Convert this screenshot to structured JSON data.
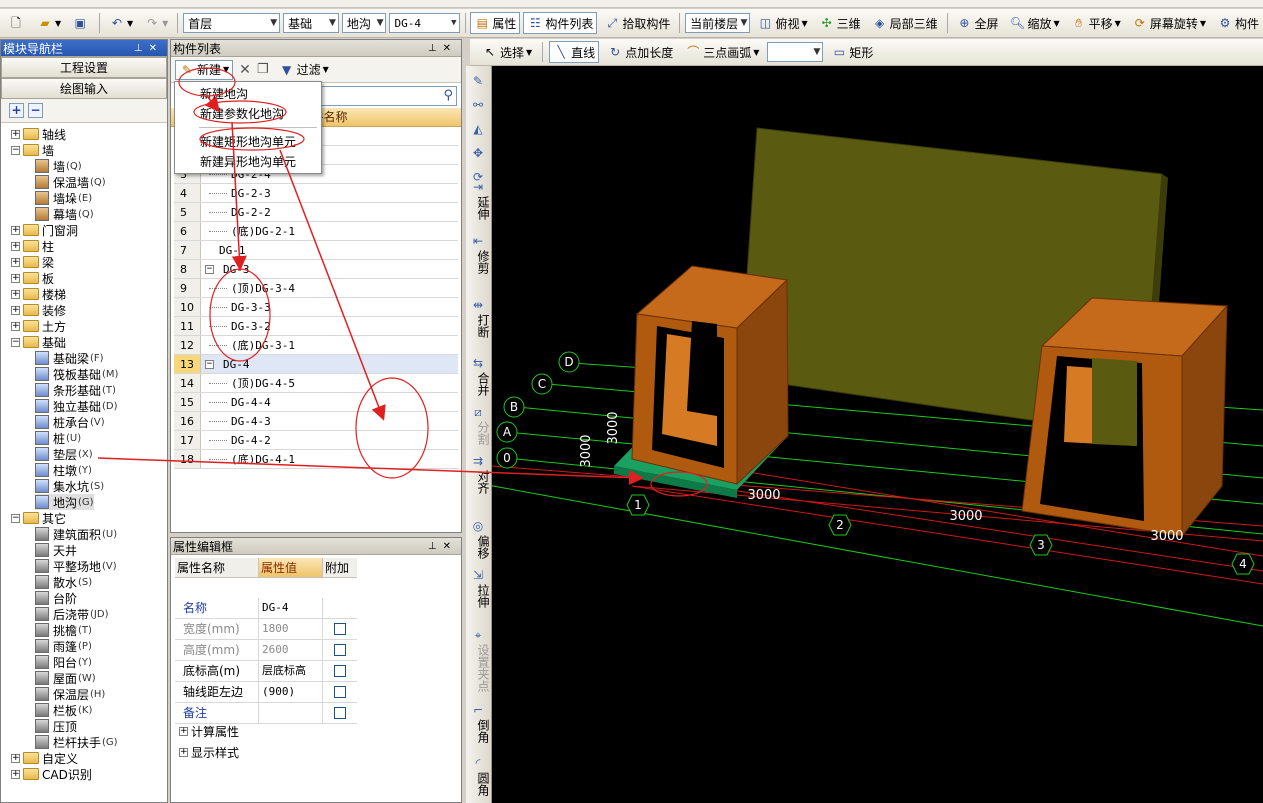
{
  "toolbar": {
    "floor": "首层",
    "category": "基础",
    "type": "地沟",
    "component": "DG-4",
    "buttons": [
      "属性",
      "构件列表",
      "拾取构件"
    ],
    "view_floor": "当前楼层",
    "view_mode": "俯视",
    "right_buttons": [
      "三维",
      "局部三维",
      "全屏",
      "缩放",
      "平移",
      "屏幕旋转",
      "构件"
    ]
  },
  "draw_toolbar": {
    "select": "选择",
    "line": "直线",
    "point_length": "点加长度",
    "arc": "三点画弧",
    "rect": "矩形"
  },
  "nav": {
    "title": "模块导航栏",
    "btn_project": "工程设置",
    "btn_draw": "绘图输入",
    "tree": [
      {
        "label": "轴线",
        "pm": "+",
        "level": 0,
        "folder": true
      },
      {
        "label": "墙",
        "pm": "-",
        "level": 0,
        "folder": true
      },
      {
        "label": "墙",
        "key": "(Q)",
        "level": 1
      },
      {
        "label": "保温墙",
        "key": "(Q)",
        "level": 1
      },
      {
        "label": "墙垛",
        "key": "(E)",
        "level": 1
      },
      {
        "label": "幕墙",
        "key": "(Q)",
        "level": 1
      },
      {
        "label": "门窗洞",
        "pm": "+",
        "level": 0,
        "folder": true
      },
      {
        "label": "柱",
        "pm": "+",
        "level": 0,
        "folder": true
      },
      {
        "label": "梁",
        "pm": "+",
        "level": 0,
        "folder": true
      },
      {
        "label": "板",
        "pm": "+",
        "level": 0,
        "folder": true
      },
      {
        "label": "楼梯",
        "pm": "+",
        "level": 0,
        "folder": true
      },
      {
        "label": "装修",
        "pm": "+",
        "level": 0,
        "folder": true
      },
      {
        "label": "土方",
        "pm": "+",
        "level": 0,
        "folder": true
      },
      {
        "label": "基础",
        "pm": "-",
        "level": 0,
        "folder": true
      },
      {
        "label": "基础梁",
        "key": "(F)",
        "level": 1
      },
      {
        "label": "筏板基础",
        "key": "(M)",
        "level": 1
      },
      {
        "label": "条形基础",
        "key": "(T)",
        "level": 1
      },
      {
        "label": "独立基础",
        "key": "(D)",
        "level": 1
      },
      {
        "label": "桩承台",
        "key": "(V)",
        "level": 1
      },
      {
        "label": "桩",
        "key": "(U)",
        "level": 1
      },
      {
        "label": "垫层",
        "key": "(X)",
        "level": 1
      },
      {
        "label": "柱墩",
        "key": "(Y)",
        "level": 1
      },
      {
        "label": "集水坑",
        "key": "(S)",
        "level": 1
      },
      {
        "label": "地沟",
        "key": "(G)",
        "level": 1
      },
      {
        "label": "其它",
        "pm": "-",
        "level": 0,
        "folder": true
      },
      {
        "label": "建筑面积",
        "key": "(U)",
        "level": 1
      },
      {
        "label": "天井",
        "key": "",
        "level": 1
      },
      {
        "label": "平整场地",
        "key": "(V)",
        "level": 1
      },
      {
        "label": "散水",
        "key": "(S)",
        "level": 1
      },
      {
        "label": "台阶",
        "key": "",
        "level": 1
      },
      {
        "label": "后浇带",
        "key": "(JD)",
        "level": 1
      },
      {
        "label": "挑檐",
        "key": "(T)",
        "level": 1
      },
      {
        "label": "雨篷",
        "key": "(P)",
        "level": 1
      },
      {
        "label": "阳台",
        "key": "(Y)",
        "level": 1
      },
      {
        "label": "屋面",
        "key": "(W)",
        "level": 1
      },
      {
        "label": "保温层",
        "key": "(H)",
        "level": 1
      },
      {
        "label": "栏板",
        "key": "(K)",
        "level": 1
      },
      {
        "label": "压顶",
        "key": "",
        "level": 1
      },
      {
        "label": "栏杆扶手",
        "key": "(G)",
        "level": 1
      },
      {
        "label": "自定义",
        "pm": "+",
        "level": 0,
        "folder": true
      },
      {
        "label": "CAD识别",
        "pm": "+",
        "level": 0,
        "folder": true
      }
    ]
  },
  "complist": {
    "title": "构件列表",
    "new_btn": "新建",
    "filter_btn": "过滤",
    "col_name": "件名称",
    "rows": [
      {
        "n": "3",
        "name": "DG-2-4",
        "indent": 2
      },
      {
        "n": "4",
        "name": "DG-2-3",
        "indent": 2
      },
      {
        "n": "5",
        "name": "DG-2-2",
        "indent": 2
      },
      {
        "n": "6",
        "name": "(底)DG-2-1",
        "indent": 2
      },
      {
        "n": "7",
        "name": "DG-1",
        "indent": 1
      },
      {
        "n": "8",
        "name": "DG-3",
        "indent": 0,
        "pm": "-"
      },
      {
        "n": "9",
        "name": "(顶)DG-3-4",
        "indent": 2
      },
      {
        "n": "10",
        "name": "DG-3-3",
        "indent": 2
      },
      {
        "n": "11",
        "name": "DG-3-2",
        "indent": 2
      },
      {
        "n": "12",
        "name": "(底)DG-3-1",
        "indent": 2
      },
      {
        "n": "13",
        "name": "DG-4",
        "indent": 0,
        "pm": "-",
        "sel": true
      },
      {
        "n": "14",
        "name": "(顶)DG-4-5",
        "indent": 2
      },
      {
        "n": "15",
        "name": "DG-4-4",
        "indent": 2
      },
      {
        "n": "16",
        "name": "DG-4-3",
        "indent": 2
      },
      {
        "n": "17",
        "name": "DG-4-2",
        "indent": 2
      },
      {
        "n": "18",
        "name": "(底)DG-4-1",
        "indent": 2
      }
    ],
    "menu": [
      "新建地沟",
      "新建参数化地沟",
      "新建矩形地沟单元",
      "新建异形地沟单元"
    ]
  },
  "props": {
    "title": "属性编辑框",
    "h1": "属性名称",
    "h2": "属性值",
    "h3": "附加",
    "rows": [
      {
        "name": "名称",
        "val": "DG-4",
        "cls": "blue",
        "chk": false
      },
      {
        "name": "宽度(mm)",
        "val": "1800",
        "cls": "grey",
        "chk": true
      },
      {
        "name": "高度(mm)",
        "val": "2600",
        "cls": "grey",
        "chk": true
      },
      {
        "name": "底标高(m)",
        "val": "层底标高",
        "cls": "",
        "chk": true
      },
      {
        "name": "轴线距左边",
        "val": "(900)",
        "cls": "",
        "chk": true
      },
      {
        "name": "备注",
        "val": "",
        "cls": "blue",
        "chk": true
      }
    ],
    "calc": "计算属性",
    "display": "显示样式"
  },
  "vtool": [
    "延伸",
    "修剪",
    "打断",
    "合并",
    "分割",
    "对齐",
    "偏移",
    "拉伸",
    "设置夹点",
    "倒角",
    "圆角"
  ],
  "viewport": {
    "axes_letters": [
      "D",
      "C",
      "B",
      "A",
      "0"
    ],
    "axes_numbers": [
      "1",
      "2",
      "3",
      "4"
    ],
    "dims": [
      "3000",
      "3000",
      "3000",
      "3000",
      "3000"
    ],
    "colors": {
      "bg": "#000000",
      "wall": "#5a5a10",
      "box": "#b05a10",
      "pad": "#1aa060",
      "grid_green": "#1ec81e",
      "grid_red": "#d01818"
    }
  }
}
